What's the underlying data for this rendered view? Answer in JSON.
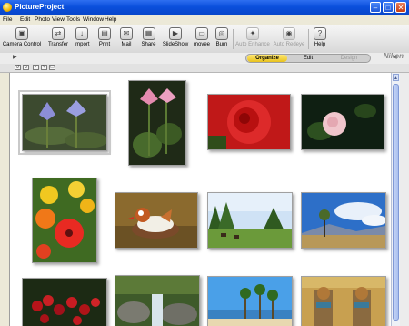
{
  "window": {
    "title": "PictureProject"
  },
  "menu": [
    "File",
    "Edit",
    "Photo",
    "View",
    "Tools",
    "Window",
    "Help"
  ],
  "toolbar": [
    {
      "label": "Camera Control",
      "icon": "camera-control-icon",
      "glyph": "▣",
      "enabled": true
    },
    {
      "label": "Transfer",
      "icon": "transfer-icon",
      "glyph": "⇄",
      "enabled": true
    },
    {
      "label": "Import",
      "icon": "import-icon",
      "glyph": "↓",
      "enabled": true
    },
    {
      "label": "Print",
      "icon": "print-icon",
      "glyph": "▤",
      "enabled": true
    },
    {
      "label": "Mail",
      "icon": "mail-icon",
      "glyph": "✉",
      "enabled": true
    },
    {
      "label": "Share",
      "icon": "share-icon",
      "glyph": "▦",
      "enabled": true
    },
    {
      "label": "SlideShow",
      "icon": "slideshow-icon",
      "glyph": "▶",
      "enabled": true
    },
    {
      "label": "movee",
      "icon": "movee-icon",
      "glyph": "▭",
      "enabled": true
    },
    {
      "label": "Burn",
      "icon": "burn-icon",
      "glyph": "◎",
      "enabled": true
    },
    {
      "label": "Auto Enhance",
      "icon": "auto-enhance-icon",
      "glyph": "✦",
      "enabled": false
    },
    {
      "label": "Auto Redeye",
      "icon": "auto-redeye-icon",
      "glyph": "◉",
      "enabled": false
    },
    {
      "label": "Help",
      "icon": "help-icon",
      "glyph": "?",
      "enabled": true
    }
  ],
  "brand": "Nikon",
  "modes": [
    {
      "label": "Organize",
      "active": true,
      "enabled": true
    },
    {
      "label": "Edit",
      "active": false,
      "enabled": true
    },
    {
      "label": "Design",
      "active": false,
      "enabled": false
    }
  ],
  "accent_colors": {
    "titlebar": "#0a4fdc",
    "mode_active": "#f3d53a"
  },
  "thumbnails": [
    {
      "name": "water-lilies-purple",
      "selected": true
    },
    {
      "name": "pink-lotus-flowers",
      "selected": false
    },
    {
      "name": "red-rose",
      "selected": false
    },
    {
      "name": "pink-flower-dark-background",
      "selected": false
    },
    {
      "name": "red-yellow-poppies",
      "selected": false
    },
    {
      "name": "mandarin-duck",
      "selected": false
    },
    {
      "name": "forest-meadow-horses",
      "selected": false
    },
    {
      "name": "mountain-landscape-tree",
      "selected": false
    },
    {
      "name": "red-berries",
      "selected": false
    },
    {
      "name": "waterfall-rocks",
      "selected": false
    },
    {
      "name": "palm-beach",
      "selected": false
    },
    {
      "name": "temple-statues",
      "selected": false
    }
  ]
}
